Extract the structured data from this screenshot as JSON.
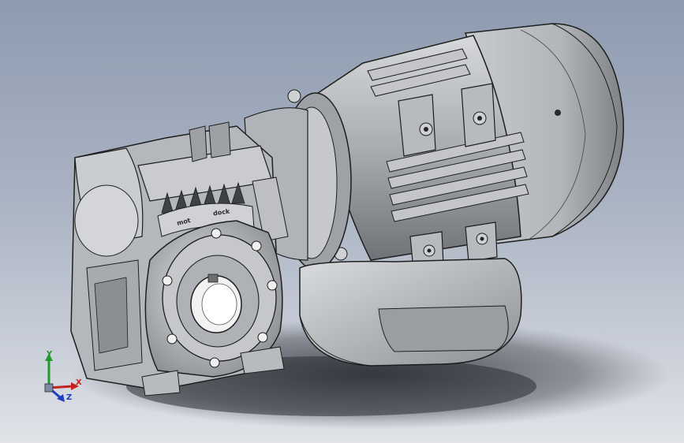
{
  "scene": {
    "background_top": "#8e9bb0",
    "background_bottom": "#e1e3e8",
    "part_color": "#b9bcc0",
    "edge_color": "#1e1e1e"
  },
  "gear_text": {
    "left": "mot",
    "right": "dock"
  },
  "triad": {
    "x_label": "X",
    "y_label": "Y",
    "z_label": "Z",
    "x_color": "#c62020",
    "y_color": "#1f9b2e",
    "z_color": "#1d3fbf"
  }
}
